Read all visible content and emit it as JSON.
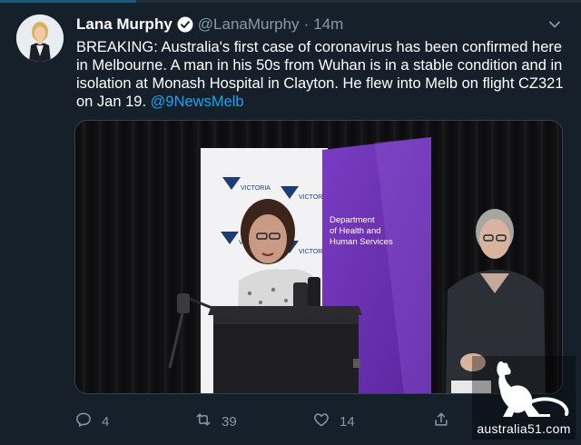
{
  "tweet": {
    "display_name": "Lana Murphy",
    "handle": "@LanaMurphy",
    "separator": "·",
    "timestamp": "14m",
    "text": "BREAKING: Australia's first case of coronavirus has been confirmed here in Melbourne. A man in his 50s from Wuhan is in a stable condition and in isolation at Monash Hospital in Clayton. He flew into Melb on flight CZ321 on Jan 19.",
    "mention": "@9NewsMelb"
  },
  "media": {
    "banner_left_text": "VICTORIA",
    "banner_right_lines": [
      "Department",
      "of Health and",
      "Human Services"
    ]
  },
  "actions": {
    "reply_count": "4",
    "retweet_count": "39",
    "like_count": "14"
  },
  "watermark": {
    "text": "australia51.com"
  },
  "colors": {
    "background": "#15202b",
    "accent": "#1da1f2",
    "muted": "#8899a6",
    "banner_purple": "#6a2fb0"
  },
  "icons": [
    "verified-badge-icon",
    "chevron-down-icon",
    "reply-icon",
    "retweet-icon",
    "like-icon",
    "share-icon",
    "kangaroo-icon"
  ]
}
